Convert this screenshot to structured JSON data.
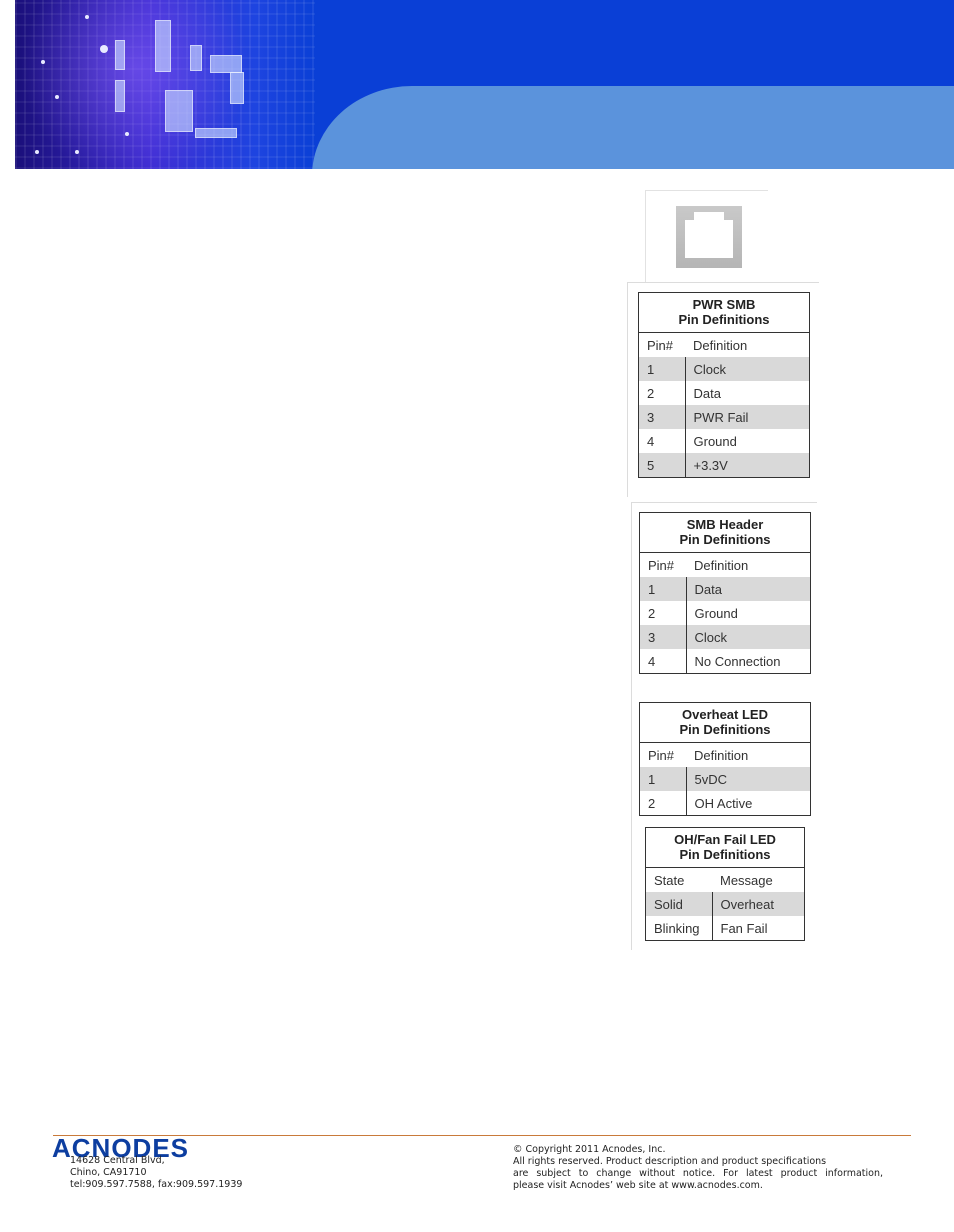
{
  "header": {
    "banner_colors": {
      "dark_blue": "#0a3fd6",
      "light_blue": "#5b93dc"
    }
  },
  "connector_image": {
    "icon": "pwr-smb-connector-icon"
  },
  "tables": [
    {
      "title_line1": "PWR SMB",
      "title_line2": "Pin Definitions",
      "col1": "Pin#",
      "col2": "Definition",
      "rows": [
        {
          "c1": "1",
          "c2": "Clock"
        },
        {
          "c1": "2",
          "c2": "Data"
        },
        {
          "c1": "3",
          "c2": "PWR Fail"
        },
        {
          "c1": "4",
          "c2": "Ground"
        },
        {
          "c1": "5",
          "c2": "+3.3V"
        }
      ]
    },
    {
      "title_line1": "SMB Header",
      "title_line2": "Pin Definitions",
      "col1": "Pin#",
      "col2": "Definition",
      "rows": [
        {
          "c1": "1",
          "c2": "Data"
        },
        {
          "c1": "2",
          "c2": "Ground"
        },
        {
          "c1": "3",
          "c2": "Clock"
        },
        {
          "c1": "4",
          "c2": "No Connection"
        }
      ]
    },
    {
      "title_line1": "Overheat LED",
      "title_line2": "Pin Definitions",
      "col1": "Pin#",
      "col2": "Definition",
      "rows": [
        {
          "c1": "1",
          "c2": "5vDC"
        },
        {
          "c1": "2",
          "c2": "OH Active"
        }
      ]
    },
    {
      "title_line1": "OH/Fan Fail LED",
      "title_line2": "Pin Definitions",
      "col1": "State",
      "col2": "Message",
      "rows": [
        {
          "c1": "Solid",
          "c2": "Overheat"
        },
        {
          "c1": "Blinking",
          "c2": "Fan Fail"
        }
      ]
    }
  ],
  "footer": {
    "logo": "ACNODES",
    "address_line1": "14628 Central Blvd,",
    "address_line2": "Chino, CA91710",
    "address_line3": "tel:909.597.7588, fax:909.597.1939",
    "copyright_line1": "© Copyright 2011 Acnodes, Inc.",
    "copyright_line2": "All rights reserved. Product description and product specifications",
    "copyright_line3": "are subject to change without notice. For latest product information,",
    "copyright_line4": "please visit Acnodes’ web site at www.acnodes.com.",
    "accent_color": "#c97a3a",
    "logo_color": "#0d3ea0"
  }
}
